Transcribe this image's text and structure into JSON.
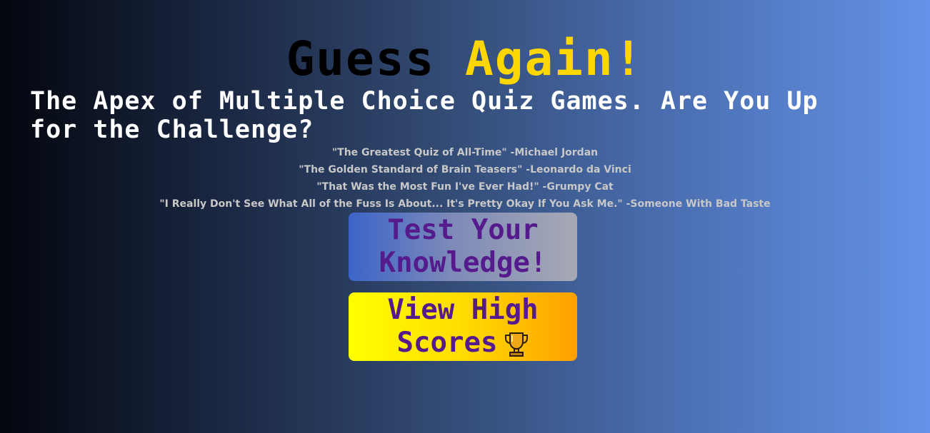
{
  "header": {
    "title_part1": "Guess",
    "title_part2": "Again!",
    "tagline": "The Apex of Multiple Choice Quiz Games. Are You Up for the Challenge?"
  },
  "quotes": [
    "\"The Greatest Quiz of All-Time\" -Michael Jordan",
    "\"The Golden Standard of Brain Teasers\" -Leonardo da Vinci",
    "\"That Was the Most Fun I've Ever Had!\" -Grumpy Cat",
    "\"I Really Don't See What All of the Fuss Is About... It's Pretty Okay If You Ask Me.\" -Someone With Bad Taste"
  ],
  "buttons": {
    "start_label": "Test Your Knowledge!",
    "high_scores_label": "View High Scores",
    "high_scores_icon": "trophy-icon"
  },
  "colors": {
    "title_dark": "#000000",
    "title_accent": "#ffd700",
    "button_text": "#551a8b",
    "quote_text": "#c8c8c8"
  }
}
